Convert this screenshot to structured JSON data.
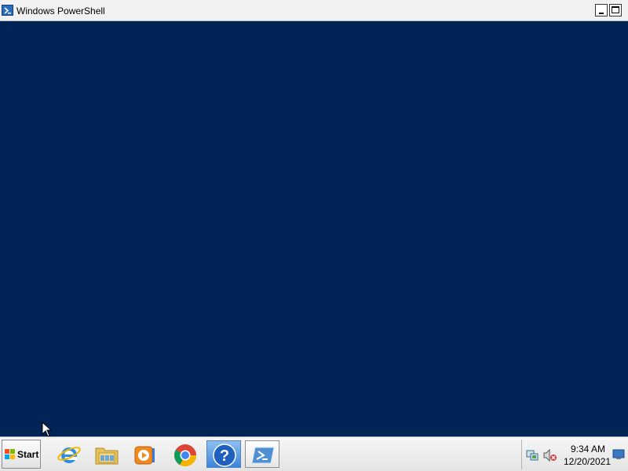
{
  "window": {
    "title": "Windows PowerShell",
    "console_background": "#012456"
  },
  "taskbar": {
    "start_label": "Start",
    "pinned": [
      {
        "name": "Internet Explorer",
        "icon": "internet-explorer-icon"
      },
      {
        "name": "Windows Explorer",
        "icon": "folder-icon"
      },
      {
        "name": "Windows Media Player",
        "icon": "media-player-icon"
      },
      {
        "name": "Google Chrome",
        "icon": "chrome-icon"
      },
      {
        "name": "Help and Support",
        "icon": "help-icon"
      },
      {
        "name": "Windows PowerShell",
        "icon": "powershell-icon"
      }
    ],
    "tray": {
      "icons": [
        "network-icon",
        "volume-muted-icon",
        "show-desktop-icon"
      ],
      "time": "9:34 AM",
      "date": "12/20/2021"
    }
  }
}
